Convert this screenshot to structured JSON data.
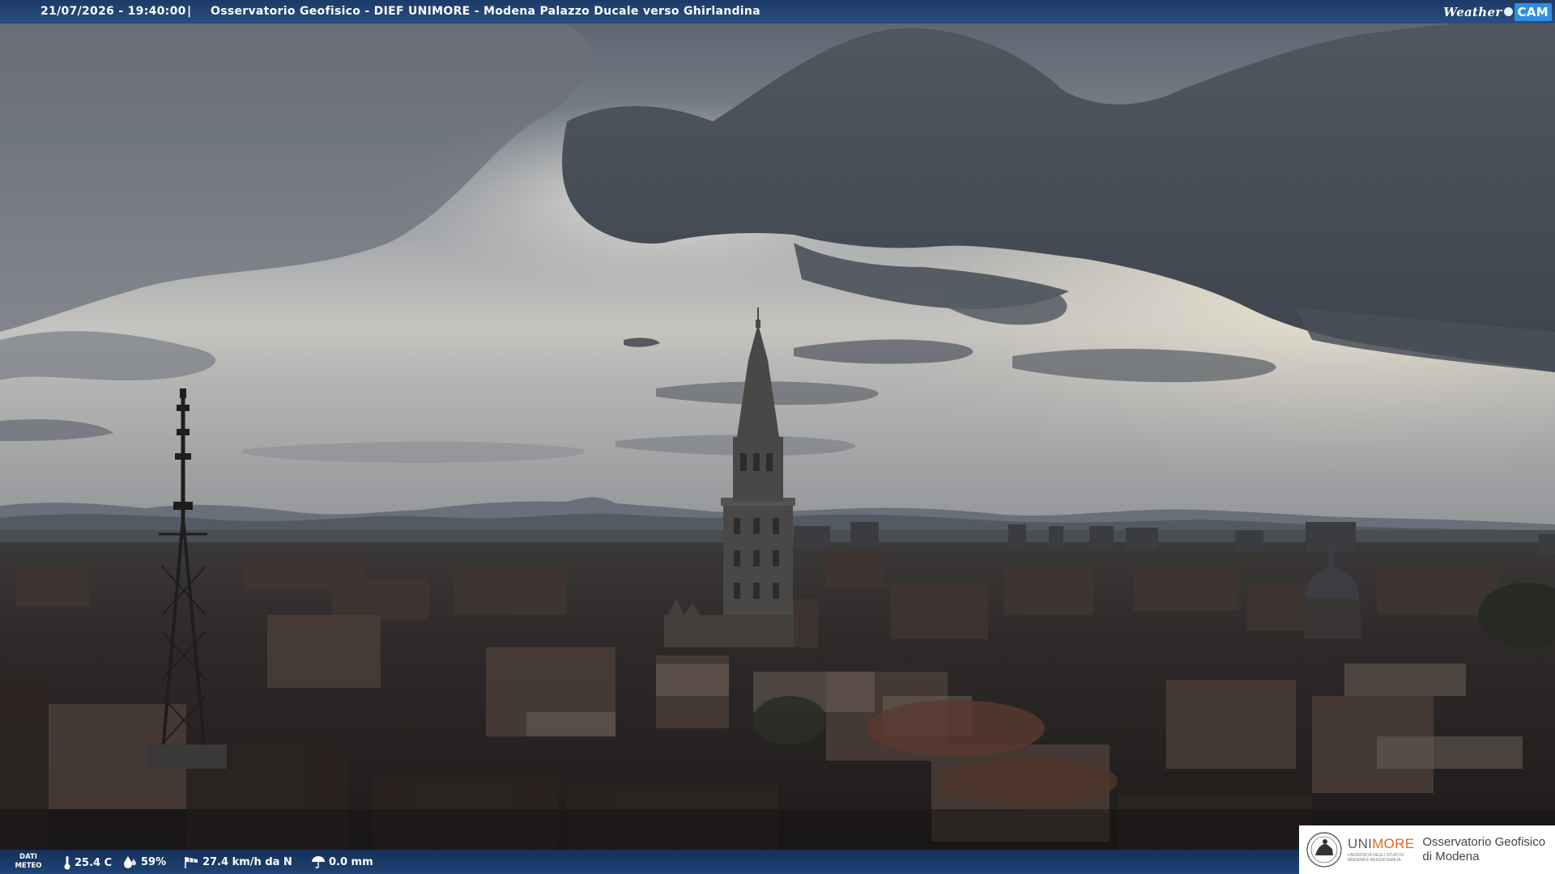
{
  "header": {
    "datetime": "21/07/2026 - 19:40:00",
    "separator": "|",
    "title": "Osservatorio Geofisico - DIEF UNIMORE - Modena Palazzo Ducale verso Ghirlandina",
    "brand_weather": "Weather",
    "brand_cam": "CAM"
  },
  "weather_bar": {
    "label_line1": "DATI",
    "label_line2": "METEO",
    "temperature": "25.4 C",
    "humidity": "59%",
    "wind": "27.4 km/h da N",
    "rain": "0.0 mm",
    "icons": [
      "thermometer-icon",
      "humidity-drop-icon",
      "wind-sock-icon",
      "rain-umbrella-icon"
    ]
  },
  "logo": {
    "brand_uni": "UNI",
    "brand_more": "MORE",
    "brand_subtitle": "UNIVERSITÀ DEGLI STUDI DI MODENA E REGGIO EMILIA",
    "observatory_line1": "Osservatorio Geofisico",
    "observatory_line2": "di Modena",
    "accent_color": "#e06a1b"
  },
  "colors": {
    "header_bg": "#1c3a66",
    "footer_bg": "#14305a",
    "wc_cam_bg": "#2e8fe0"
  }
}
